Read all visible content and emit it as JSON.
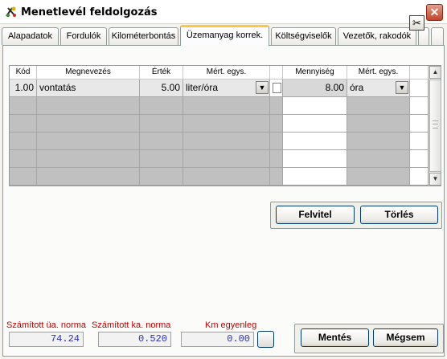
{
  "window": {
    "title": "Menetlevél feldolgozás",
    "close_label": "✕"
  },
  "tabs": [
    {
      "label": "Alapadatok"
    },
    {
      "label": "Fordulók"
    },
    {
      "label": "Kilométerbontás"
    },
    {
      "label": "Üzemanyag korrek."
    },
    {
      "label": "Költségviselők"
    },
    {
      "label": "Vezetők, rakodók"
    }
  ],
  "active_tab": "Üzemanyag korrek.",
  "grid": {
    "headers": [
      "Kód",
      "Megnevezés",
      "Érték",
      "Mért. egys.",
      "",
      "Mennyiség",
      "Mért. egys."
    ],
    "rows": [
      {
        "kod": "1.00",
        "megnevezes": "vontatás",
        "ertek": "5.00",
        "mert_egys": "liter/óra",
        "mennyiseg": "8.00",
        "mert_egys2": "óra"
      }
    ],
    "empty_rows": 5
  },
  "buttons": {
    "felvitel": "Felvitel",
    "torles": "Törlés",
    "mentes": "Mentés",
    "megsem": "Mégsem"
  },
  "footer": {
    "ua_norma_label": "Számított üa. norma",
    "ua_norma_value": "74.24",
    "ka_norma_label": "Számított ka. norma",
    "ka_norma_value": "0.520",
    "km_label": "Km egyenleg",
    "km_value": "0.00"
  },
  "colors": {
    "accent_tab": "#ffc83c",
    "label_red": "#c00000",
    "value_blue": "#2d2dbf",
    "grid_empty": "#c0c0c0"
  }
}
